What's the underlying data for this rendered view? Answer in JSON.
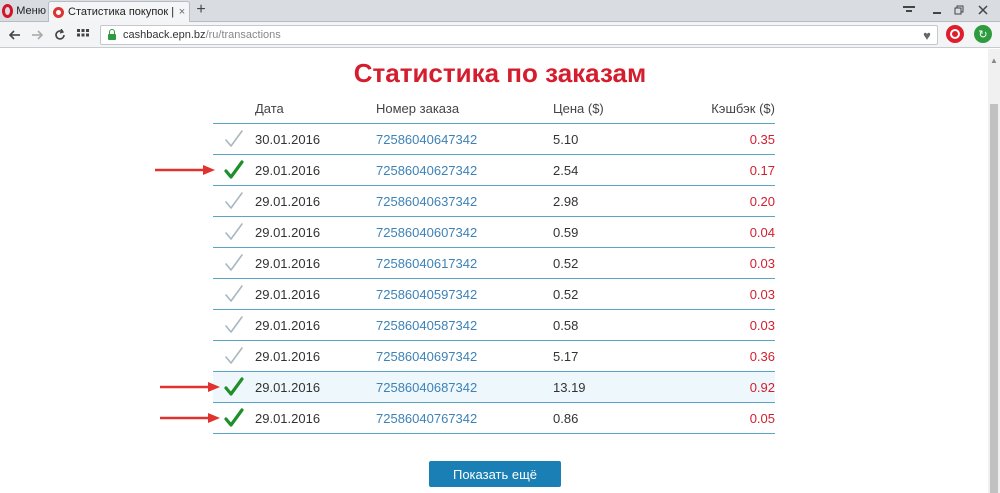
{
  "browser": {
    "menu_label": "Меню",
    "tab_title": "Статистика покупок | еПН",
    "tab_close": "×",
    "new_tab": "+",
    "url_host": "cashback.epn.bz",
    "url_path": "/ru/transactions"
  },
  "page": {
    "title": "Статистика по заказам",
    "columns": [
      "Дата",
      "Номер заказа",
      "Цена ($)",
      "Кэшбэк ($)"
    ],
    "rows": [
      {
        "status": "pending",
        "date": "30.01.2016",
        "order": "72586040647342",
        "price": "5.10",
        "cashback": "0.35"
      },
      {
        "status": "confirmed",
        "date": "29.01.2016",
        "order": "72586040627342",
        "price": "2.54",
        "cashback": "0.17"
      },
      {
        "status": "pending",
        "date": "29.01.2016",
        "order": "72586040637342",
        "price": "2.98",
        "cashback": "0.20"
      },
      {
        "status": "pending",
        "date": "29.01.2016",
        "order": "72586040607342",
        "price": "0.59",
        "cashback": "0.04"
      },
      {
        "status": "pending",
        "date": "29.01.2016",
        "order": "72586040617342",
        "price": "0.52",
        "cashback": "0.03"
      },
      {
        "status": "pending",
        "date": "29.01.2016",
        "order": "72586040597342",
        "price": "0.52",
        "cashback": "0.03"
      },
      {
        "status": "pending",
        "date": "29.01.2016",
        "order": "72586040587342",
        "price": "0.58",
        "cashback": "0.03"
      },
      {
        "status": "pending",
        "date": "29.01.2016",
        "order": "72586040697342",
        "price": "5.17",
        "cashback": "0.36"
      },
      {
        "status": "confirmed",
        "date": "29.01.2016",
        "order": "72586040687342",
        "price": "13.19",
        "cashback": "0.92"
      },
      {
        "status": "confirmed",
        "date": "29.01.2016",
        "order": "72586040767342",
        "price": "0.86",
        "cashback": "0.05"
      }
    ],
    "highlighted_rows": [
      8
    ],
    "arrow_rows": [
      1,
      8,
      9
    ],
    "show_more_label": "Показать ещё"
  },
  "colors": {
    "title_red": "#d41e2e",
    "link_blue": "#3d82b7",
    "check_confirmed": "#1e8f2b",
    "check_pending": "#a9b7c0",
    "button_blue": "#1a7fb5",
    "arrow_red": "#e0322f"
  }
}
